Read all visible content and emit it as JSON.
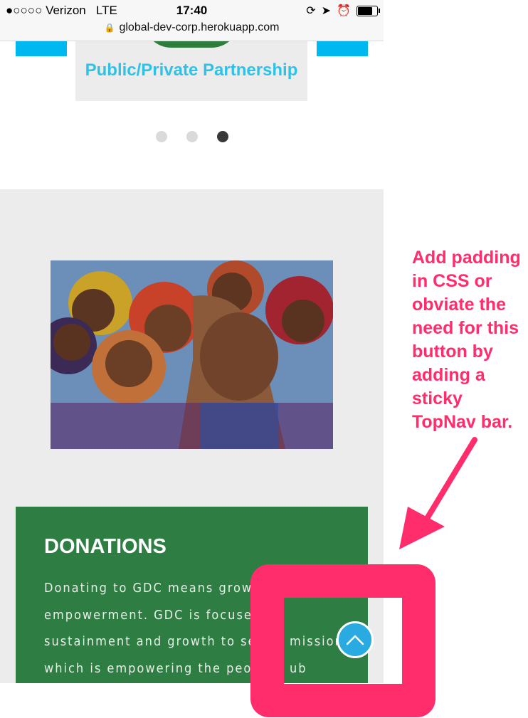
{
  "status_bar": {
    "carrier": "●○○○○ Verizon",
    "network": "LTE",
    "time": "17:40",
    "url": "global-dev-corp.herokuapp.com"
  },
  "carousel": {
    "card_title": "Public/Private Partnership",
    "dots": [
      false,
      false,
      true
    ]
  },
  "donations": {
    "heading": "DONATIONS",
    "text_lines": [
      "Donating to GDC means growth",
      "empowerment. GDC is focused o",
      "sustainment and growth to serv",
      "which is empowering the people"
    ],
    "text_tail_lines": [
      "",
      "",
      "mission",
      "ub"
    ]
  },
  "annotation": {
    "note": "Add padding in CSS or obviate the need for this button by adding a sticky TopNav bar.",
    "color": "#ff2d6b"
  },
  "colors": {
    "accent_cyan": "#2fc2e6",
    "donations_green": "#2e7d42",
    "scroll_button": "#29abe2"
  },
  "icons": {
    "scroll_top": "chevron-up-icon",
    "lock": "lock-icon"
  }
}
